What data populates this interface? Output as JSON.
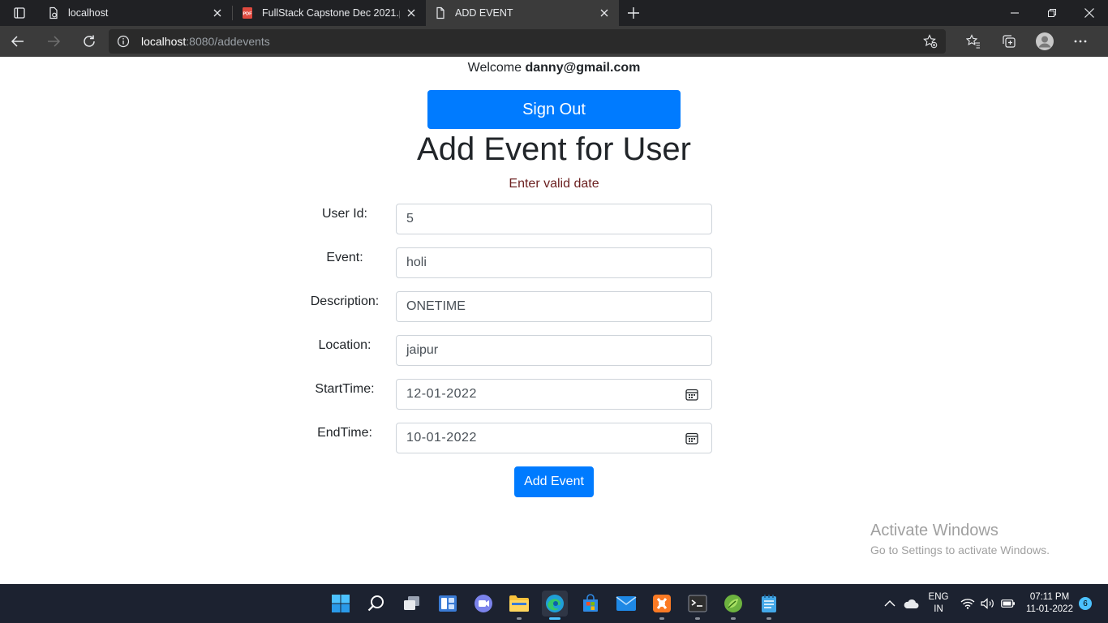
{
  "browser": {
    "tabs": [
      {
        "title": "localhost",
        "icon": "page-icon"
      },
      {
        "title": "FullStack Capstone Dec 2021.pdf",
        "icon": "pdf-icon"
      },
      {
        "title": "ADD EVENT",
        "icon": "page-icon",
        "active": true
      }
    ],
    "address": {
      "host": "localhost",
      "rest": ":8080/addevents"
    }
  },
  "page": {
    "welcome_prefix": "Welcome ",
    "welcome_user": "danny@gmail.com",
    "signout_label": "Sign Out",
    "title": "Add Event for User",
    "error": "Enter valid date",
    "form": {
      "user_id": {
        "label": "User Id:",
        "value": "5"
      },
      "event": {
        "label": "Event:",
        "value": "holi"
      },
      "description": {
        "label": "Description:",
        "value": "ONETIME"
      },
      "location": {
        "label": "Location:",
        "value": "jaipur"
      },
      "start": {
        "label": "StartTime:",
        "value": "12-01-2022"
      },
      "end": {
        "label": "EndTime:",
        "value": "10-01-2022"
      }
    },
    "submit_label": "Add Event"
  },
  "watermark": {
    "line1": "Activate Windows",
    "line2": "Go to Settings to activate Windows."
  },
  "taskbar": {
    "lang_top": "ENG",
    "lang_bottom": "IN",
    "time": "07:11 PM",
    "date": "11-01-2022",
    "notifications": "6"
  },
  "colors": {
    "primary": "#007bff",
    "error": "#6b1f1f",
    "taskbar": "#1c2230"
  }
}
